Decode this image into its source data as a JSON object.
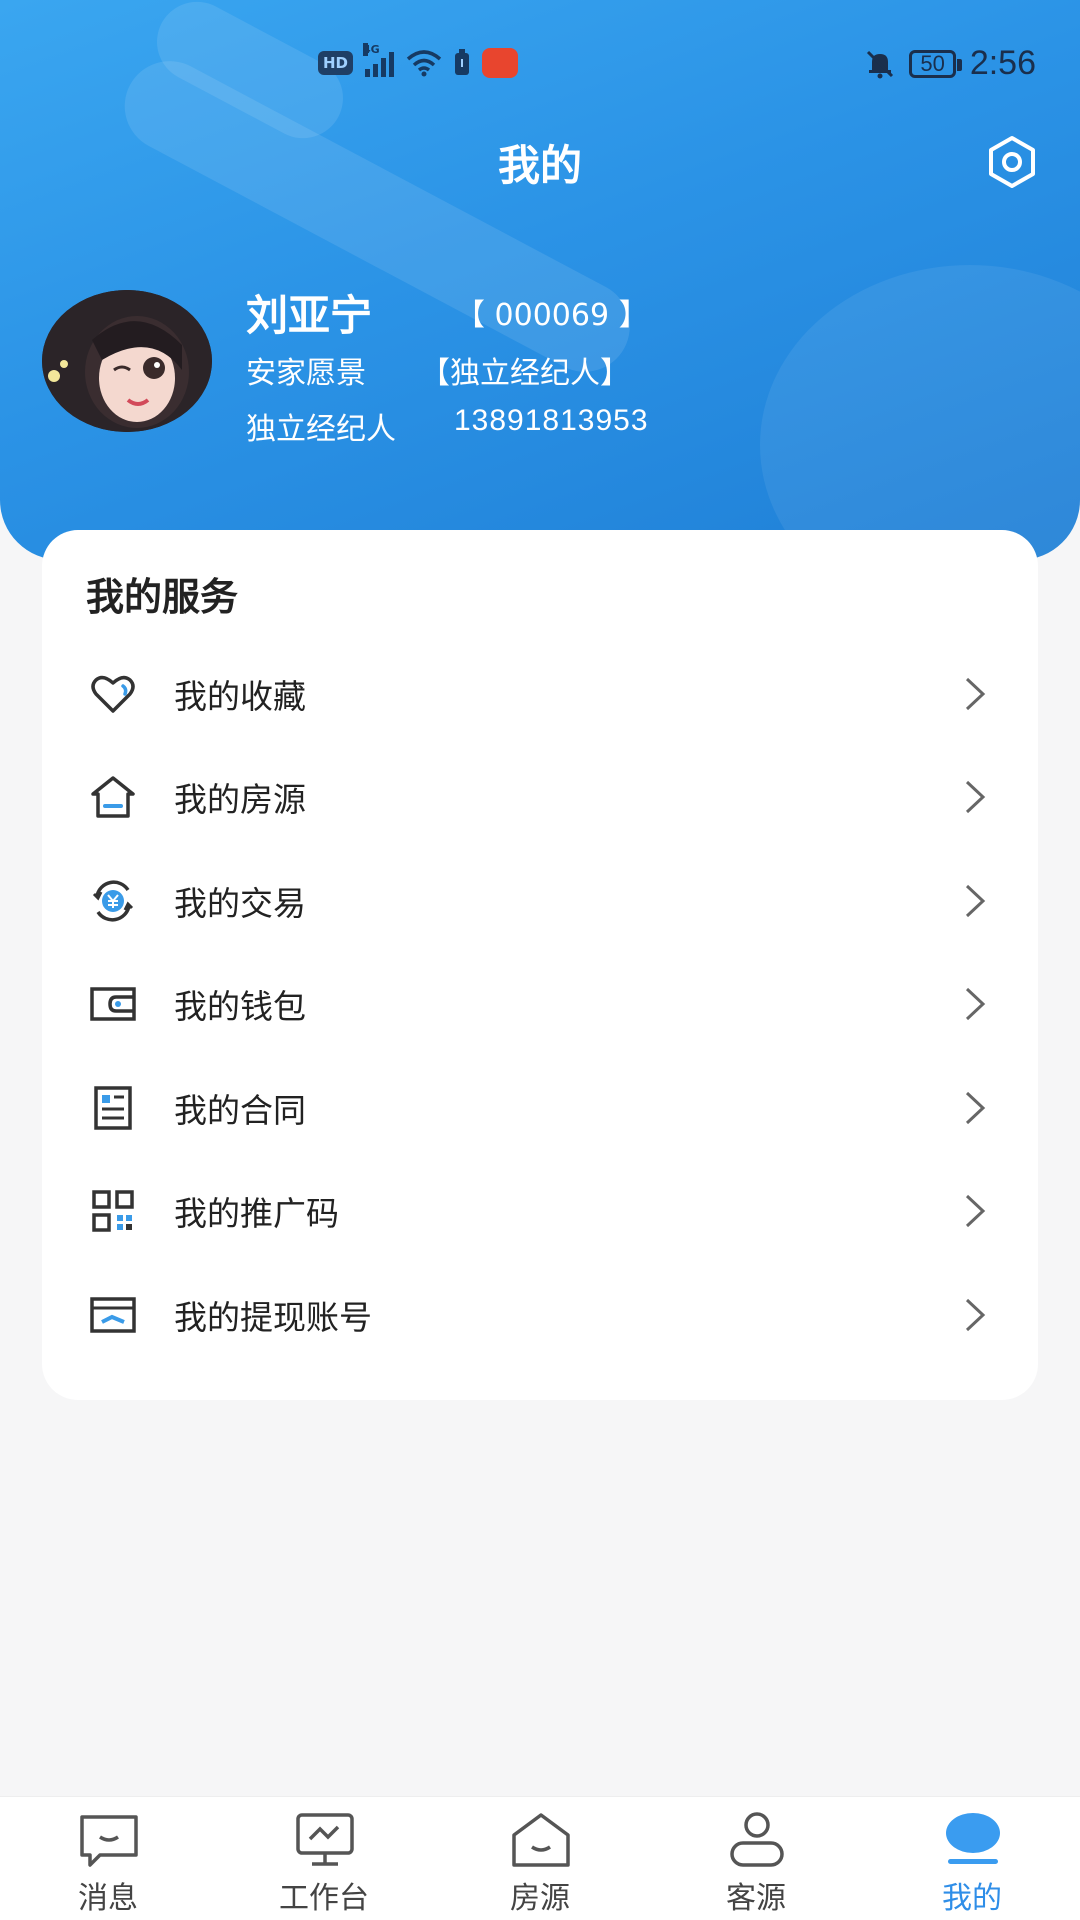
{
  "status_bar": {
    "hd": "HD",
    "network": "4G",
    "battery": "50",
    "time": "2:56"
  },
  "header": {
    "title": "我的",
    "settings_icon": "settings-hexagon-icon"
  },
  "profile": {
    "name": "刘亚宁",
    "code": "【 000069 】",
    "company": "安家愿景",
    "role_tag": "【独立经纪人】",
    "role": "独立经纪人",
    "phone": "13891813953"
  },
  "services": {
    "title": "我的服务",
    "items": [
      {
        "label": "我的收藏",
        "icon": "heart-icon"
      },
      {
        "label": "我的房源",
        "icon": "house-icon"
      },
      {
        "label": "我的交易",
        "icon": "yuan-exchange-icon"
      },
      {
        "label": "我的钱包",
        "icon": "wallet-icon"
      },
      {
        "label": "我的合同",
        "icon": "contract-icon"
      },
      {
        "label": "我的推广码",
        "icon": "qr-code-icon"
      },
      {
        "label": "我的提现账号",
        "icon": "card-icon"
      }
    ]
  },
  "tabbar": {
    "items": [
      {
        "label": "消息",
        "icon": "message-icon"
      },
      {
        "label": "工作台",
        "icon": "monitor-icon"
      },
      {
        "label": "房源",
        "icon": "house-icon"
      },
      {
        "label": "客源",
        "icon": "person-icon"
      },
      {
        "label": "我的",
        "icon": "profile-icon",
        "active": true
      }
    ]
  },
  "colors": {
    "brand": "#2b93e6",
    "active_tab": "#2f8ee8",
    "accent_icon": "#3a9be8"
  }
}
